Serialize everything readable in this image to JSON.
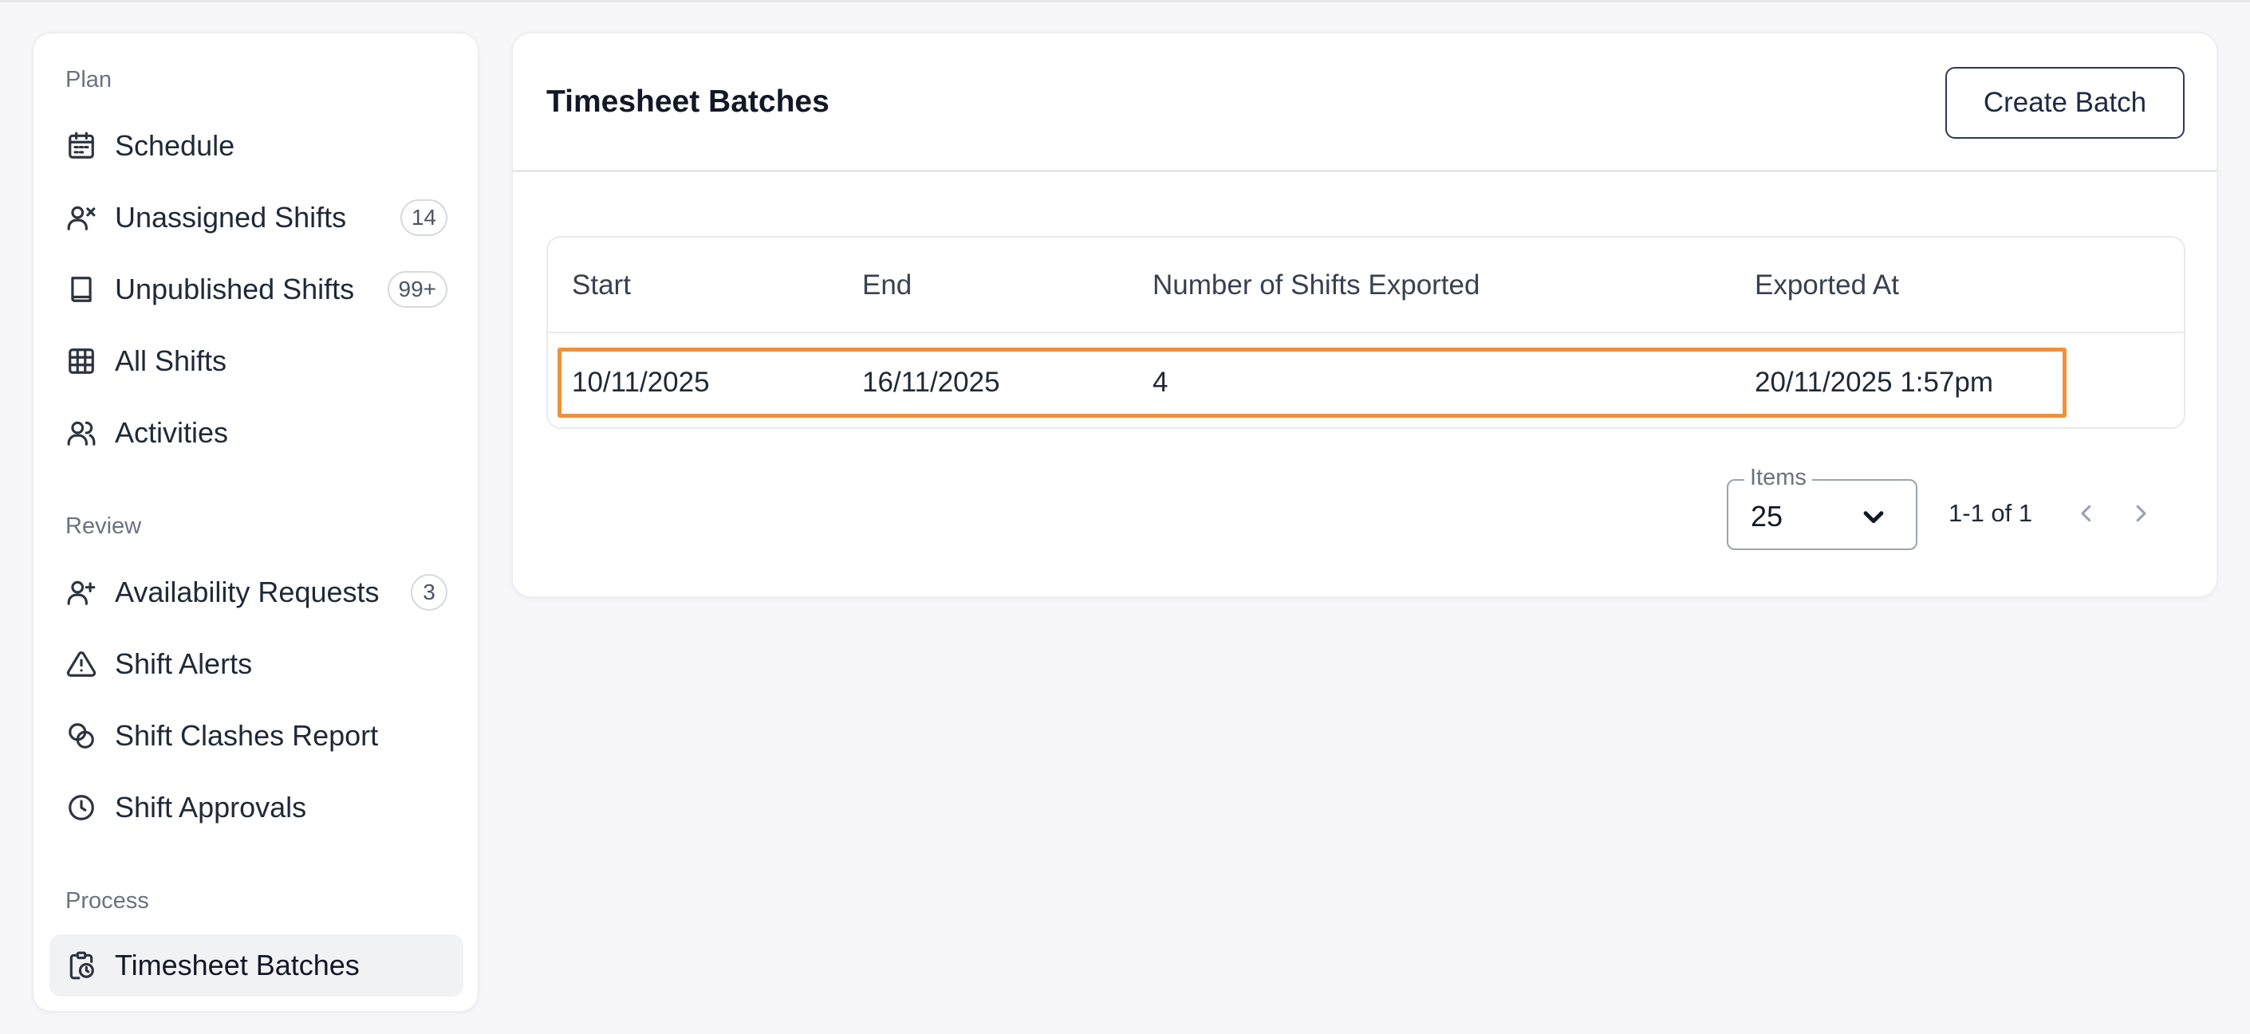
{
  "sidebar": {
    "sections": [
      {
        "title": "Plan",
        "items": [
          {
            "label": "Schedule",
            "icon": "calendar-icon"
          },
          {
            "label": "Unassigned Shifts",
            "icon": "user-x-icon",
            "badge": "14"
          },
          {
            "label": "Unpublished Shifts",
            "icon": "book-icon",
            "badge": "99+"
          },
          {
            "label": "All Shifts",
            "icon": "table-grid-icon"
          },
          {
            "label": "Activities",
            "icon": "users-icon"
          }
        ]
      },
      {
        "title": "Review",
        "items": [
          {
            "label": "Availability Requests",
            "icon": "user-plus-icon",
            "badge": "3"
          },
          {
            "label": "Shift Alerts",
            "icon": "warning-triangle-icon"
          },
          {
            "label": "Shift Clashes Report",
            "icon": "overlap-circles-icon"
          },
          {
            "label": "Shift Approvals",
            "icon": "clock-icon"
          }
        ]
      },
      {
        "title": "Process",
        "items": [
          {
            "label": "Timesheet Batches",
            "icon": "clipboard-clock-icon",
            "active": true
          }
        ]
      }
    ]
  },
  "main": {
    "title": "Timesheet Batches",
    "create_button_label": "Create Batch",
    "table": {
      "columns": [
        "Start",
        "End",
        "Number of Shifts Exported",
        "Exported At"
      ],
      "rows": [
        [
          "10/11/2025",
          "16/11/2025",
          "4",
          "20/11/2025 1:57pm"
        ]
      ]
    },
    "pagination": {
      "items_label": "Items",
      "items_value": "25",
      "range_text": "1-1 of 1"
    }
  },
  "colors": {
    "highlight": "#f0913a",
    "button_border": "#2b3a55"
  }
}
